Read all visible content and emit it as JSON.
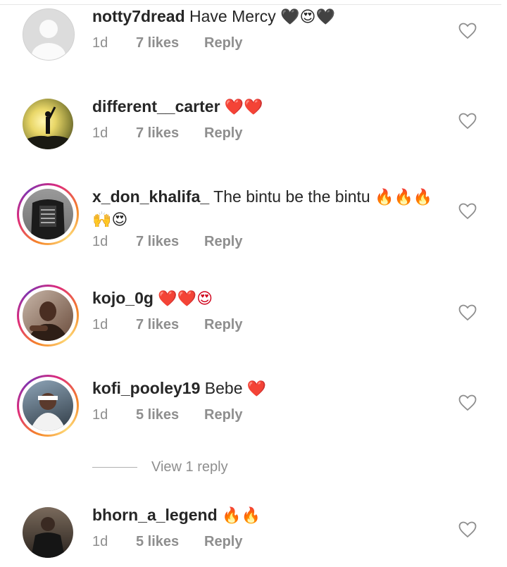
{
  "comments": [
    {
      "username": "notty7dread",
      "text": "Have Mercy",
      "emoji": "🖤😍🖤",
      "time": "1d",
      "likes": "7 likes",
      "reply": "Reply",
      "ring": false
    },
    {
      "username": "different__carter",
      "text": "",
      "emoji": "❤️❤️",
      "time": "1d",
      "likes": "7 likes",
      "reply": "Reply",
      "ring": false
    },
    {
      "username": "x_don_khalifa_",
      "text": "The bintu be the bintu",
      "emoji": "🔥🔥🔥",
      "emoji2": "🙌😍",
      "time": "1d",
      "likes": "7 likes",
      "reply": "Reply",
      "ring": true
    },
    {
      "username": "kojo_0g",
      "text": "",
      "emoji": "❤️❤️😍",
      "time": "1d",
      "likes": "7 likes",
      "reply": "Reply",
      "ring": true
    },
    {
      "username": "kofi_pooley19",
      "text": "Bebe",
      "emoji": "❤️",
      "time": "1d",
      "likes": "5 likes",
      "reply": "Reply",
      "ring": true
    },
    {
      "username": "bhorn_a_legend",
      "text": "",
      "emoji": "🔥🔥",
      "time": "1d",
      "likes": "5 likes",
      "reply": "Reply",
      "ring": false
    }
  ],
  "view_replies": "View 1 reply",
  "colors": {
    "ring_start": "#f58529",
    "ring_mid": "#dd2a7b",
    "ring_end": "#8134af",
    "meta": "#8e8e8e"
  },
  "icons": {
    "like": "heart-outline-icon"
  }
}
